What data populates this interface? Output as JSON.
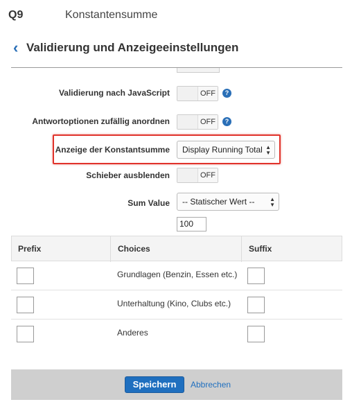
{
  "header": {
    "question_id": "Q9",
    "question_type": "Konstantensumme"
  },
  "section": {
    "back_icon": "chevron-left-icon",
    "title": "Validierung und Anzeigeeinstellungen"
  },
  "settings": {
    "validation_js": {
      "label": "Validierung nach JavaScript",
      "state": "OFF"
    },
    "randomize": {
      "label": "Antwortoptionen zufällig anordnen",
      "state": "OFF"
    },
    "display_constant_sum": {
      "label": "Anzeige der Konstantsumme",
      "value": "Display Running Total"
    },
    "hide_slider": {
      "label": "Schieber ausblenden",
      "state": "OFF"
    },
    "sum_value": {
      "label": "Sum Value",
      "value": "-- Statischer Wert --",
      "input_value": "100"
    },
    "help_glyph": "?",
    "select_arrows": "▲▼"
  },
  "table": {
    "headers": {
      "prefix": "Prefix",
      "choices": "Choices",
      "suffix": "Suffix"
    },
    "rows": [
      {
        "choice": "Grundlagen (Benzin, Essen etc.)"
      },
      {
        "choice": "Unterhaltung (Kino, Clubs etc.)"
      },
      {
        "choice": "Anderes"
      }
    ]
  },
  "footer": {
    "save_label": "Speichern",
    "cancel_label": "Abbrechen"
  },
  "colors": {
    "accent": "#1f6fbf",
    "highlight": "#e0332b",
    "footer_bg": "#cfcfcf"
  }
}
